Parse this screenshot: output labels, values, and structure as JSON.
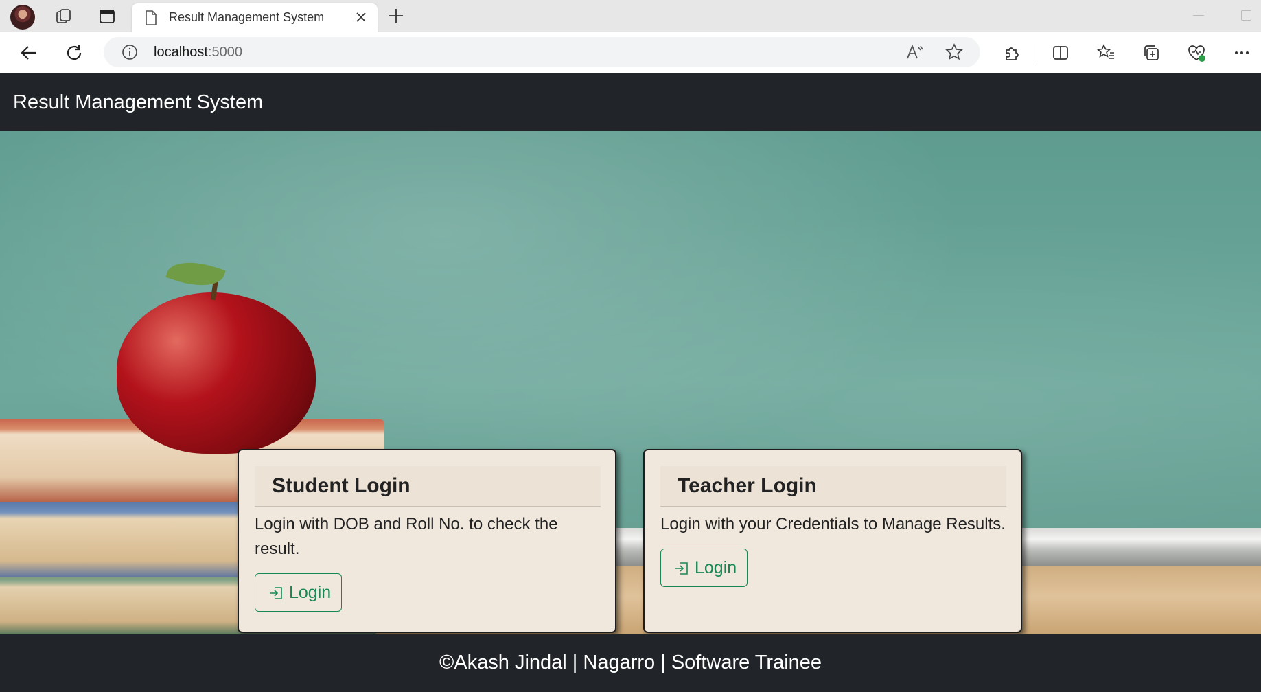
{
  "browser": {
    "tab_title": "Result Management System",
    "address": {
      "host": "localhost",
      "port": ":5000"
    }
  },
  "navbar": {
    "brand": "Result Management System"
  },
  "cards": [
    {
      "title": "Student Login",
      "text": "Login with DOB and Roll No. to check the result.",
      "button_label": "Login"
    },
    {
      "title": "Teacher Login",
      "text": "Login with your Credentials to Manage Results.",
      "button_label": "Login"
    }
  ],
  "footer": {
    "text": "©Akash Jindal | Nagarro | Software Trainee"
  },
  "colors": {
    "dark": "#212529",
    "success": "#198754",
    "card_bg": "#f1e8dd"
  }
}
